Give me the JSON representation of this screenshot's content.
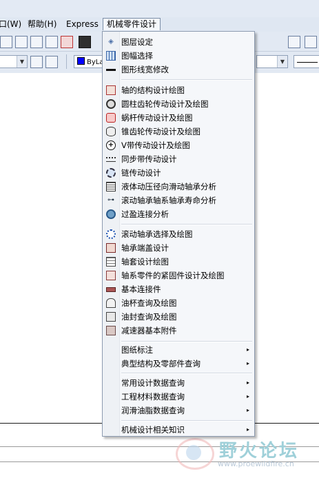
{
  "menubar": {
    "items": [
      "口(W)",
      "帮助(H)",
      "Express",
      "机械零件设计"
    ],
    "active_index": 3
  },
  "toolbar2": {
    "color_combo": "ByLa"
  },
  "menu": {
    "groups": [
      [
        "图层设定",
        "图幅选择",
        "图形线宽修改"
      ],
      [
        "轴的结构设计绘图",
        "圆柱齿轮传动设计及绘图",
        "蜗杆传动设计及绘图",
        "锥齿轮传动设计及绘图",
        "V带传动设计及绘图",
        "同步带传动设计",
        "链传动设计",
        "液体动压径向滑动轴承分析",
        "滚动轴承轴系轴承寿命分析",
        "过盈连接分析"
      ],
      [
        "滚动轴承选择及绘图",
        "轴承端盖设计",
        "轴套设计绘图",
        "轴系零件的紧固件设计及绘图",
        "基本连接件",
        "油杯查询及绘图",
        "油封查询及绘图",
        "减速器基本附件"
      ],
      [
        "图纸标注",
        "典型结构及零部件查询"
      ],
      [
        "常用设计数据查询",
        "工程材料数据查询",
        "润滑油脂数据查询"
      ],
      [
        "机械设计相关知识"
      ]
    ],
    "submenu_arrow": "▸"
  },
  "watermark": {
    "text": "野火论坛",
    "url": "www.proewildfire.cn"
  }
}
